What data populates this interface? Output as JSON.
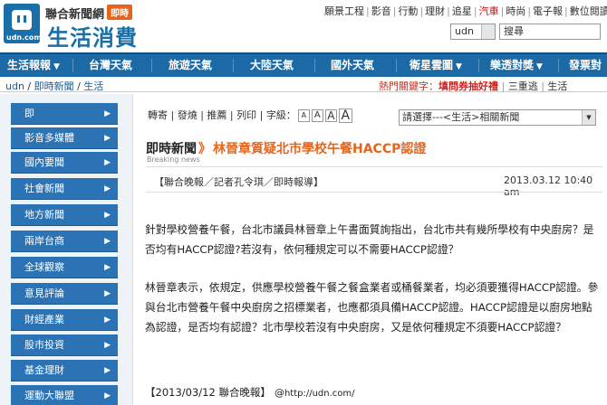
{
  "brand": {
    "network": "聯合新聞網",
    "tag": "即時",
    "name": "生活消費",
    "logo_text": "udn.com"
  },
  "top_links": [
    "願景工程",
    "影音",
    "行動",
    "理財",
    "追星",
    "汽車",
    "時尚",
    "電子報",
    "數位閱讀"
  ],
  "search": {
    "scope": "udn",
    "placeholder": "搜尋"
  },
  "nav": [
    {
      "label": "生活報報",
      "has_arrow": true
    },
    {
      "label": "台灣天氣",
      "has_arrow": false
    },
    {
      "label": "旅遊天氣",
      "has_arrow": false
    },
    {
      "label": "大陸天氣",
      "has_arrow": false
    },
    {
      "label": "國外天氣",
      "has_arrow": false
    },
    {
      "label": "衛星雲圖",
      "has_arrow": true
    },
    {
      "label": "樂透對獎",
      "has_arrow": true
    },
    {
      "label": "發票對",
      "has_arrow": false
    }
  ],
  "breadcrumb": [
    "udn",
    "即時新聞",
    "生活"
  ],
  "keywords": {
    "label": "熱門關鍵字：",
    "link": "填問券抽好禮",
    "extra": "三重逃",
    "extra2": "生活"
  },
  "sidebar": [
    "即",
    "影音多媒體",
    "國內要聞",
    "社會新聞",
    "地方新聞",
    "兩岸台商",
    "全球觀察",
    "意見評論",
    "財經產業",
    "股市投資",
    "基金理財",
    "運動大聯盟"
  ],
  "tools": {
    "links": [
      "轉寄",
      "發燒",
      "推薦",
      "列印"
    ],
    "font_label": "字級：",
    "font_sizes": [
      "A",
      "A",
      "A",
      "A"
    ]
  },
  "related_select": "請選擇---<生活>相關新聞",
  "article": {
    "section": "即時新聞",
    "section_sub": "Breaking news",
    "headline": "林晉章質疑北市學校午餐HACCP認證",
    "source": "【聯合晚報／記者孔令琪／即時報導】",
    "timestamp": "2013.03.12 10:40 am",
    "paragraph1": "針對學校營養午餐，台北市議員林晉章上午書面質詢指出，台北市共有幾所學校有中央廚房？是否均有HACCP認證?若沒有，依何種規定可以不需要HACCP認證？",
    "paragraph2": "林晉章表示，依規定，供應學校營養午餐之餐盒業者或桶餐業者，均必須要獲得HACCP認證。參與台北市營養午餐中央廚房之招標業者，也應都須具備HACCP認證。HACCP認證是以廚房地點為認證，是否均有認證？北市學校若沒有中央廚房，又是依何種規定不須要HACCP認證？",
    "footer": "【2013/03/12 聯合晚報】",
    "footer_at": "@",
    "footer_url": "http://udn.com/"
  },
  "colors": {
    "nav_blue": "#1b6aa5",
    "sidebar_blue": "#2b73b4",
    "accent_orange": "#e8641b",
    "keyword_red": "#d02020"
  }
}
